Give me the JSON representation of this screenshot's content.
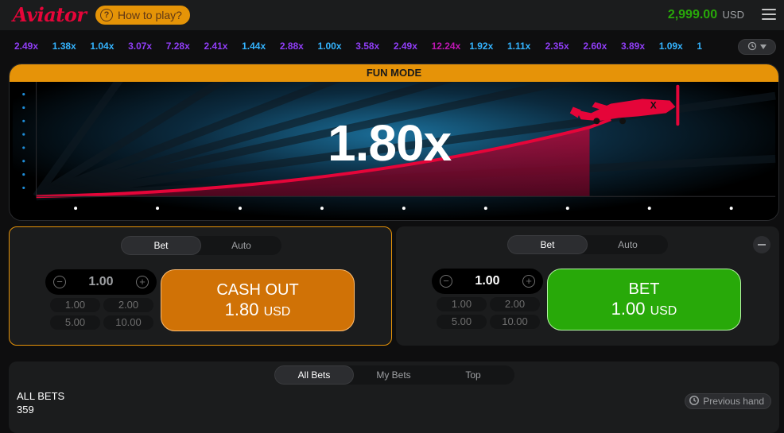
{
  "header": {
    "logo": "Aviator",
    "how_to_play": "How to play?",
    "balance": "2,999.00",
    "currency": "USD"
  },
  "history": {
    "multipliers": [
      {
        "v": "2.49x",
        "c": "#913ef8"
      },
      {
        "v": "1.38x",
        "c": "#34b4ff"
      },
      {
        "v": "1.04x",
        "c": "#34b4ff"
      },
      {
        "v": "3.07x",
        "c": "#913ef8"
      },
      {
        "v": "7.28x",
        "c": "#913ef8"
      },
      {
        "v": "2.41x",
        "c": "#913ef8"
      },
      {
        "v": "1.44x",
        "c": "#34b4ff"
      },
      {
        "v": "2.88x",
        "c": "#913ef8"
      },
      {
        "v": "1.00x",
        "c": "#34b4ff"
      },
      {
        "v": "3.58x",
        "c": "#913ef8"
      },
      {
        "v": "2.49x",
        "c": "#913ef8"
      },
      {
        "v": "12.24x",
        "c": "#c017b4"
      },
      {
        "v": "1.92x",
        "c": "#34b4ff"
      },
      {
        "v": "1.11x",
        "c": "#34b4ff"
      },
      {
        "v": "2.35x",
        "c": "#913ef8"
      },
      {
        "v": "2.60x",
        "c": "#913ef8"
      },
      {
        "v": "3.89x",
        "c": "#913ef8"
      },
      {
        "v": "1.09x",
        "c": "#34b4ff"
      },
      {
        "v": "1",
        "c": "#34b4ff"
      }
    ]
  },
  "game": {
    "banner": "FUN MODE",
    "multiplier": "1.80x",
    "accent": "#e50539"
  },
  "left_panel": {
    "tabs": [
      "Bet",
      "Auto"
    ],
    "stake": "1.00",
    "quick": [
      "1.00",
      "2.00",
      "5.00",
      "10.00"
    ],
    "action_line1": "CASH OUT",
    "action_value": "1.80",
    "action_currency": "USD"
  },
  "right_panel": {
    "tabs": [
      "Bet",
      "Auto"
    ],
    "stake": "1.00",
    "quick": [
      "1.00",
      "2.00",
      "5.00",
      "10.00"
    ],
    "action_line1": "BET",
    "action_value": "1.00",
    "action_currency": "USD"
  },
  "bets": {
    "tabs": [
      "All Bets",
      "My Bets",
      "Top"
    ],
    "title": "ALL BETS",
    "count": "359",
    "previous_hand": "Previous hand"
  }
}
